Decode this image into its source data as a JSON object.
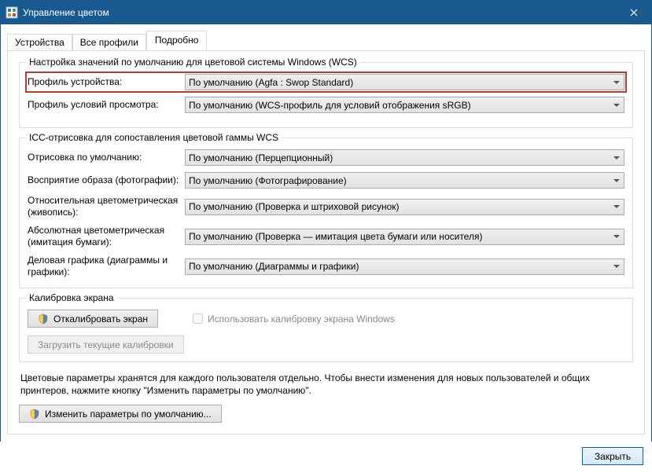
{
  "window": {
    "title": "Управление цветом"
  },
  "tabs": {
    "devices": "Устройства",
    "all_profiles": "Все профили",
    "advanced": "Подробно"
  },
  "group1": {
    "legend": "Настройка значений по умолчанию для цветовой системы Windows (WCS)",
    "device_profile_label": "Профиль устройства:",
    "device_profile_value": "По умолчанию (Agfa : Swop Standard)",
    "viewing_profile_label": "Профиль условий просмотра:",
    "viewing_profile_value": "По умолчанию (WCS-профиль для условий отображения sRGB)"
  },
  "group2": {
    "legend": "ICC-отрисовка для сопоставления цветовой гаммы WCS",
    "default_render_label": "Отрисовка по умолчанию:",
    "default_render_value": "По умолчанию (Перцепционный)",
    "perceptual_label": "Восприятие образа (фотографии):",
    "perceptual_value": "По умолчанию (Фотографирование)",
    "relative_label": "Относительная цветометрическая (живопись):",
    "relative_value": "По умолчанию (Проверка и штриховой рисунок)",
    "absolute_label": "Абсолютная цветометрическая (имитация бумаги):",
    "absolute_value": "По умолчанию (Проверка — имитация цвета бумаги или носителя)",
    "business_label": "Деловая графика (диаграммы и графики):",
    "business_value": "По умолчанию (Диаграммы и графики)"
  },
  "group3": {
    "legend": "Калибровка экрана",
    "calibrate_btn": "Откалибровать экран",
    "use_calibration_checkbox": "Использовать калибровку экрана Windows",
    "load_calibration_btn": "Загрузить текущие калибровки"
  },
  "footer": {
    "text": "Цветовые параметры хранятся для каждого пользователя отдельно. Чтобы внести изменения для новых пользователей и общих принтеров, нажмите кнопку \"Изменить параметры по умолчанию\".",
    "change_defaults_btn": "Изменить параметры по умолчанию...",
    "close_btn": "Закрыть"
  }
}
